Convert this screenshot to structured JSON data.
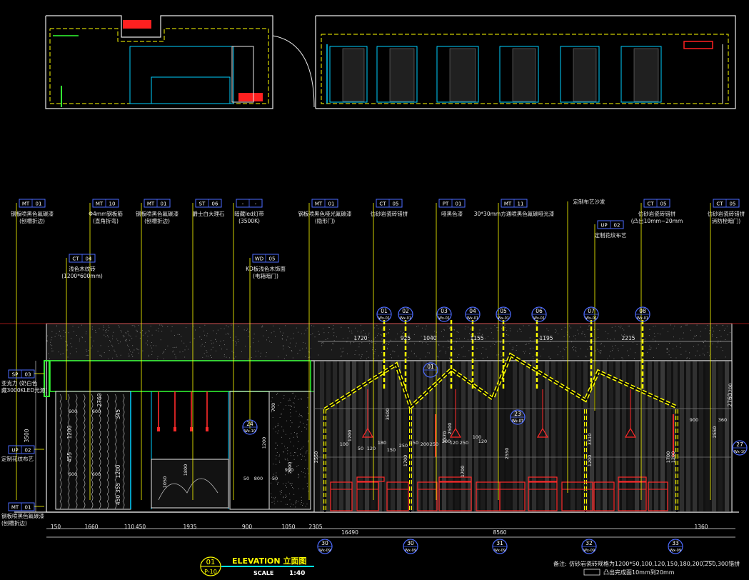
{
  "colors": {
    "background": "#000000",
    "leader": "#ffff00",
    "tag_box": "#4d6bff",
    "text": "#e8e8e8",
    "dimension": "#e8e8e8",
    "glass_green": "#33ff33",
    "wall_blue": "#00ffff",
    "lamp_red": "#ff2a2a",
    "title_cyan": "#00ffff"
  },
  "material_tags": [
    {
      "code": "MT",
      "num": "01",
      "lines": [
        "钢板喷黑色氟碳漆",
        "(刨槽折边)"
      ]
    },
    {
      "code": "MT",
      "num": "10",
      "lines": [
        "Φ4mm钢板筋",
        "(直角折弯)"
      ]
    },
    {
      "code": "MT",
      "num": "01",
      "lines": [
        "钢板喷黑色氟碳漆",
        "(刨槽折边)"
      ]
    },
    {
      "code": "ST",
      "num": "06",
      "lines": [
        "爵士白大理石"
      ]
    },
    {
      "code": "-",
      "num": "-",
      "lines": [
        "暗藏led灯带",
        "(3500K)"
      ]
    },
    {
      "code": "MT",
      "num": "01",
      "lines": [
        "钢板喷黑色哑光氟碳漆",
        "(隐形门)"
      ]
    },
    {
      "code": "CT",
      "num": "05",
      "lines": [
        "仿砂岩瓷砖错拼"
      ]
    },
    {
      "code": "PT",
      "num": "01",
      "lines": [
        "哑黑色漆"
      ]
    },
    {
      "code": "MT",
      "num": "11",
      "lines": [
        "30*30mm方通喷黑色氟碳哑光漆"
      ]
    },
    {
      "code": "",
      "num": "",
      "lines": [
        "定制布艺沙发"
      ]
    },
    {
      "code": "CT",
      "num": "05",
      "lines": [
        "仿砂岩瓷砖错拼",
        "(凸出10mm~20mm"
      ]
    },
    {
      "code": "CT",
      "num": "05",
      "lines": [
        "仿砂岩瓷砖错拼",
        "消防栓暗门)"
      ]
    }
  ],
  "secondary_tags": [
    {
      "code": "CT",
      "num": "04",
      "lines": [
        "浅色木纹砖",
        "(1200*600mm)"
      ]
    },
    {
      "code": "WD",
      "num": "05",
      "lines": [
        "KD板浅色木饰面",
        "(电箱暗门)"
      ]
    },
    {
      "code": "UP",
      "num": "02",
      "lines": [
        "定制花纹布艺"
      ]
    }
  ],
  "left_tags": [
    {
      "code": "SP",
      "num": "03",
      "lines": [
        "亚克力 (奶白色",
        "藏3000KLED光源)"
      ]
    },
    {
      "code": "UP",
      "num": "02",
      "lines": [
        "定制花纹布艺"
      ]
    },
    {
      "code": "MT",
      "num": "01",
      "lines": [
        "钢板喷黑色氟碳漆",
        "(刨槽折边)"
      ]
    }
  ],
  "frame_markers": [
    "01",
    "02",
    "03",
    "04",
    "05",
    "06",
    "07",
    "08"
  ],
  "frame_marker_sub": "Wx-01",
  "section_markers": [
    {
      "num": "30",
      "sub": "Wx-09"
    },
    {
      "num": "30",
      "sub": "Wx-09"
    },
    {
      "num": "31",
      "sub": "Wx-09"
    },
    {
      "num": "32",
      "sub": "Wx-09"
    },
    {
      "num": "33",
      "sub": "Wx-09"
    }
  ],
  "detail_callouts": [
    {
      "num": "24",
      "sub": "Wx-10"
    },
    {
      "num": "23",
      "sub": "Wx-07"
    },
    {
      "num": "27",
      "sub": "Wx-10"
    },
    {
      "num": "01",
      "sub": ""
    }
  ],
  "bottom_dims": [
    "150",
    "1660",
    "110",
    "450",
    "1935",
    "900",
    "1050",
    "2305",
    "16490",
    "8560",
    "1360"
  ],
  "top_dims": [
    "1720",
    "925",
    "1040",
    "1155",
    "1195",
    "2215"
  ],
  "left_dims": [
    "3500",
    "2760",
    "1200",
    "345",
    "455",
    "1200",
    "355",
    "450",
    "2760"
  ],
  "misc_dims": [
    "600",
    "600",
    "600",
    "600",
    "1050",
    "1800",
    "50",
    "800",
    "50",
    "2000",
    "990",
    "700",
    "1200",
    "2550",
    "100",
    "1200",
    "50",
    "120",
    "180",
    "150",
    "250",
    "150",
    "200",
    "250",
    "300",
    "120",
    "250",
    "100",
    "120",
    "2500",
    "3370",
    "1700",
    "2550",
    "3310",
    "1200",
    "900",
    "360",
    "1700",
    "3500",
    "1700",
    "2550",
    "1200",
    "1200"
  ],
  "title": {
    "num": "01",
    "sheet": "P-10",
    "name": "ELEVATION 立面图",
    "scale_label": "SCALE",
    "scale_value": "1:40"
  },
  "note": {
    "prefix": "备注:",
    "line1": "仿砂岩瓷砖规格为1200*50,100,120,150,180,200,250,300错拼",
    "line2": "凸出完成面10mm到20mm"
  }
}
